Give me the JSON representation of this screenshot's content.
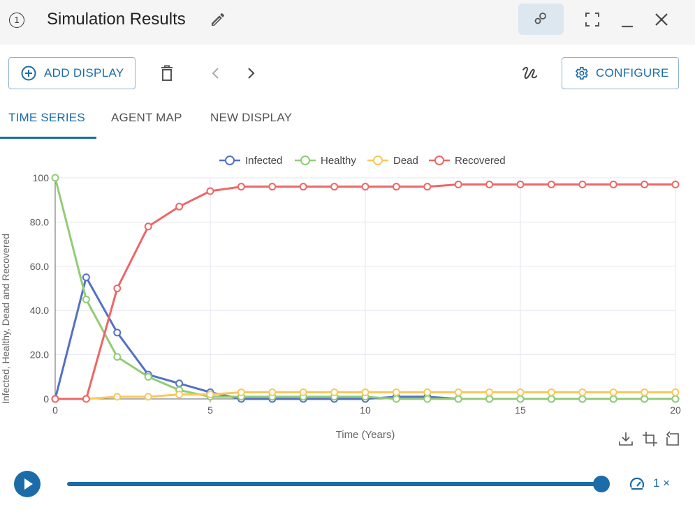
{
  "window": {
    "step_number": "1",
    "title": "Simulation Results",
    "edit_icon": "pencil-icon",
    "toggle_icon": "circles-link-icon",
    "fullscreen_icon": "fullscreen-icon",
    "minimize_icon": "minimize-icon",
    "close_icon": "close-icon"
  },
  "toolbar": {
    "add_display_label": "ADD DISPLAY",
    "add_display_icon": "plus-circle-icon",
    "delete_icon": "trash-icon",
    "prev_icon": "chevron-left-icon",
    "next_icon": "chevron-right-icon",
    "curve_icon": "squiggle-icon",
    "configure_label": "CONFIGURE",
    "configure_icon": "gear-icon"
  },
  "tabs": [
    {
      "label": "TIME SERIES",
      "active": true
    },
    {
      "label": "AGENT MAP",
      "active": false
    },
    {
      "label": "NEW DISPLAY",
      "active": false
    }
  ],
  "chart_tools": {
    "download_icon": "download-icon",
    "zoom_icon": "zoom-select-icon",
    "reset_icon": "reset-zoom-icon"
  },
  "playback": {
    "play_icon": "play-icon",
    "progress": 1.0,
    "speed_icon": "speedometer-icon",
    "speed_label": "1 ×"
  },
  "colors": {
    "accent": "#1b6ca8",
    "infected": "#5470c6",
    "healthy": "#91cc75",
    "dead": "#fac858",
    "recovered": "#ee6666"
  },
  "chart_data": {
    "type": "line",
    "xlabel": "Time (Years)",
    "ylabel": "Infected, Healthy, Dead and Recovered",
    "xlim": [
      0,
      20
    ],
    "ylim": [
      0,
      100
    ],
    "x_ticks": [
      "0",
      "5",
      "10",
      "15",
      "20"
    ],
    "y_ticks": [
      "0",
      "20.0",
      "40.0",
      "60.0",
      "80.0",
      "100"
    ],
    "legend_position": "top-center",
    "grid": true,
    "x": [
      0,
      1,
      2,
      3,
      4,
      5,
      6,
      7,
      8,
      9,
      10,
      11,
      12,
      13,
      14,
      15,
      16,
      17,
      18,
      19,
      20
    ],
    "series": [
      {
        "name": "Infected",
        "color": "#5470c6",
        "values": [
          0,
          55,
          30,
          11,
          7,
          3,
          0,
          0,
          0,
          0,
          0,
          1,
          1,
          0,
          0,
          0,
          0,
          0,
          0,
          0,
          0
        ]
      },
      {
        "name": "Healthy",
        "color": "#91cc75",
        "values": [
          100,
          45,
          19,
          10,
          4,
          1,
          1,
          1,
          1,
          1,
          1,
          0,
          0,
          0,
          0,
          0,
          0,
          0,
          0,
          0,
          0
        ]
      },
      {
        "name": "Dead",
        "color": "#fac858",
        "values": [
          0,
          0,
          1,
          1,
          2,
          2,
          3,
          3,
          3,
          3,
          3,
          3,
          3,
          3,
          3,
          3,
          3,
          3,
          3,
          3,
          3
        ]
      },
      {
        "name": "Recovered",
        "color": "#ee6666",
        "values": [
          0,
          0,
          50,
          78,
          87,
          94,
          96,
          96,
          96,
          96,
          96,
          96,
          96,
          97,
          97,
          97,
          97,
          97,
          97,
          97,
          97
        ]
      }
    ]
  }
}
